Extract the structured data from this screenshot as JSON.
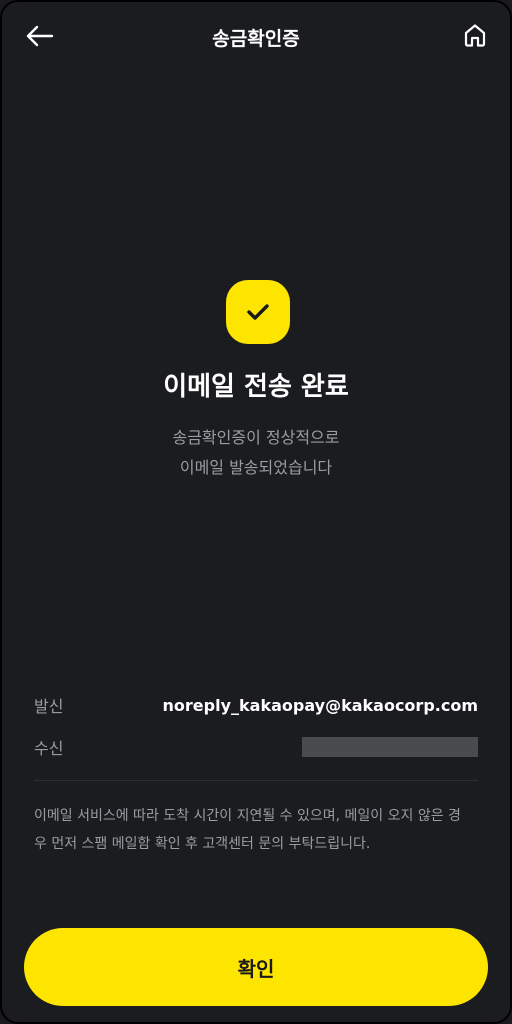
{
  "header": {
    "title": "송금확인증",
    "back_icon": "arrow-left-icon",
    "home_icon": "home-icon"
  },
  "status": {
    "icon": "check-icon",
    "title": "이메일 전송 완료",
    "description_line1": "송금확인증이 정상적으로",
    "description_line2": "이메일 발송되었습니다"
  },
  "details": {
    "sender_label": "발신",
    "sender_value": "noreply_kakaopay@kakaocorp.com",
    "recipient_label": "수신"
  },
  "notice": "이메일 서비스에 따라 도착 시간이 지연될 수 있으며, 메일이 오지 않은 경우 먼저 스팸 메일함 확인 후 고객센터 문의 부탁드립니다.",
  "actions": {
    "confirm_label": "확인"
  },
  "colors": {
    "background": "#1b1c1f",
    "accent": "#fee500",
    "muted_text": "#9a9ca1"
  }
}
